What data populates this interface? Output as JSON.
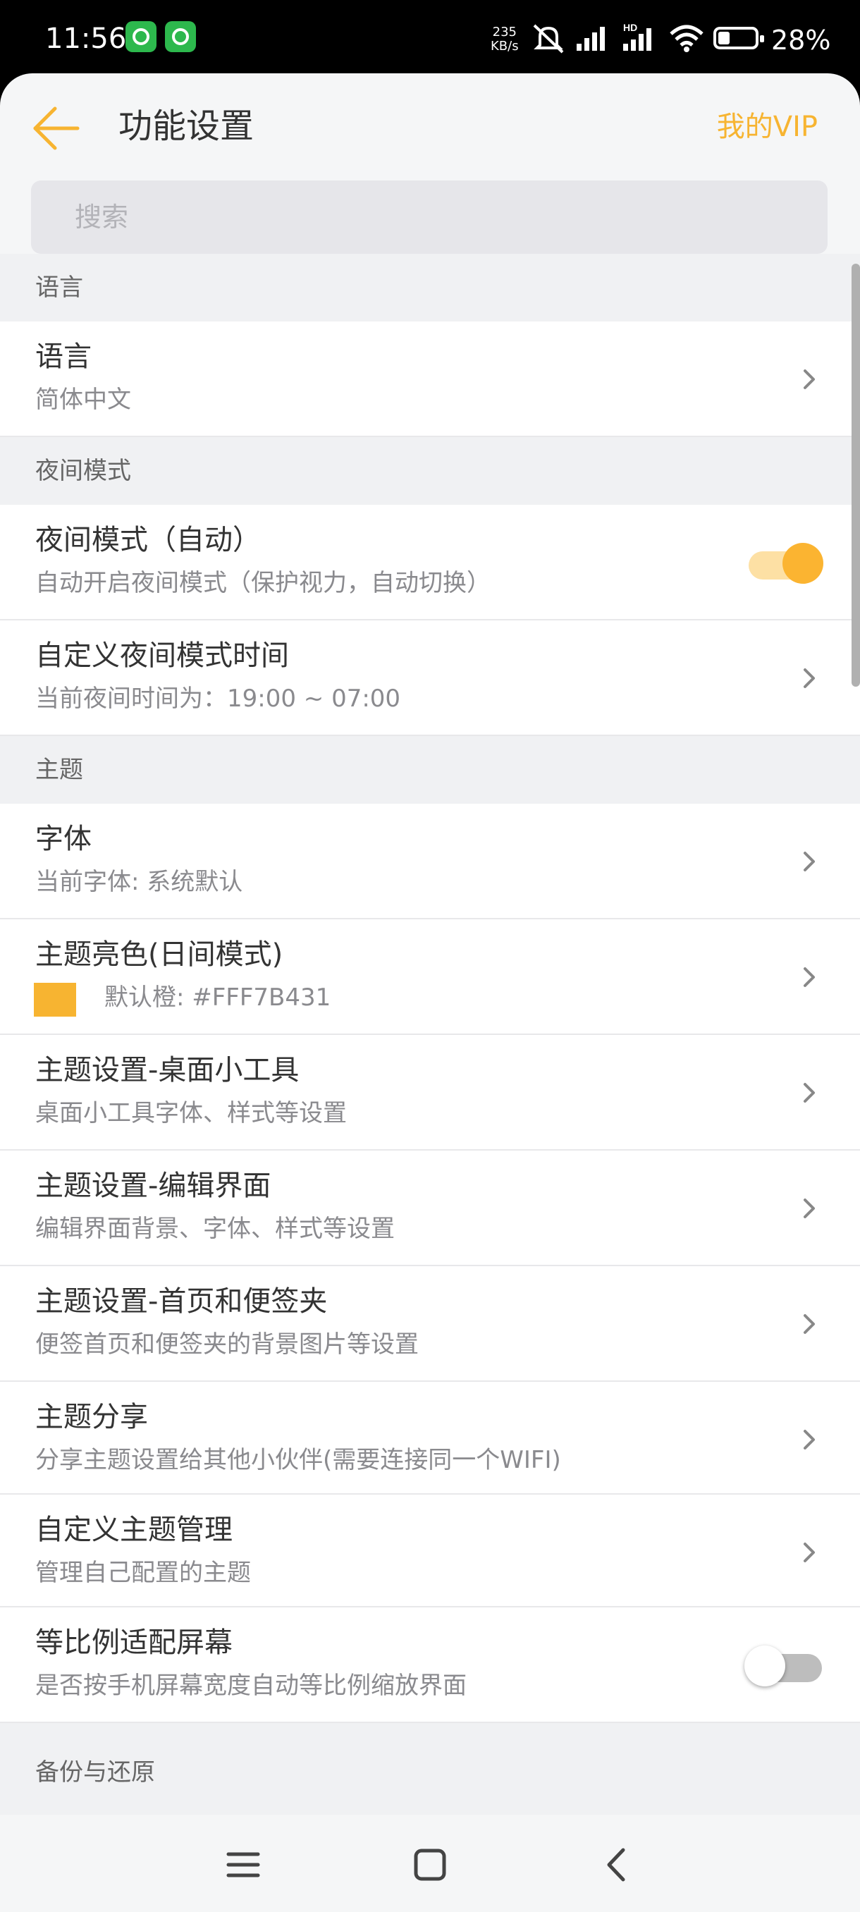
{
  "status_bar": {
    "time": "11:56",
    "net_speed_value": "235",
    "net_speed_unit": "KB/s",
    "battery": "28%",
    "icons": [
      "app-icon",
      "wechat-icon",
      "mute-icon",
      "signal-icon",
      "signal-hd-icon",
      "wifi-icon",
      "battery-icon"
    ]
  },
  "header": {
    "title": "功能设置",
    "vip_label": "我的VIP"
  },
  "search": {
    "placeholder": "搜索"
  },
  "sections": {
    "language": "语言",
    "night": "夜间模式",
    "theme": "主题",
    "backup": "备份与还原"
  },
  "items": {
    "language": {
      "title": "语言",
      "subtitle": "简体中文"
    },
    "night_auto": {
      "title": "夜间模式（自动）",
      "subtitle": "自动开启夜间模式（保护视力，自动切换）",
      "enabled": true
    },
    "night_time": {
      "title": "自定义夜间模式时间",
      "subtitle": "当前夜间时间为：19:00  ~  07:00"
    },
    "font": {
      "title": "字体",
      "subtitle": "当前字体: 系统默认"
    },
    "theme_color": {
      "title": "主题亮色(日间模式)",
      "subtitle": "默认橙: #FFF7B431",
      "swatch_color": "#F7B431"
    },
    "theme_widget": {
      "title": "主题设置-桌面小工具",
      "subtitle": "桌面小工具字体、样式等设置"
    },
    "theme_editor": {
      "title": "主题设置-编辑界面",
      "subtitle": "编辑界面背景、字体、样式等设置"
    },
    "theme_home": {
      "title": "主题设置-首页和便签夹",
      "subtitle": "便签首页和便签夹的背景图片等设置"
    },
    "theme_share": {
      "title": "主题分享",
      "subtitle": "分享主题设置给其他小伙伴(需要连接同一个WIFI)"
    },
    "theme_custom": {
      "title": "自定义主题管理",
      "subtitle": "管理自己配置的主题"
    },
    "scale_fit": {
      "title": "等比例适配屏幕",
      "subtitle": "是否按手机屏幕宽度自动等比例缩放界面",
      "enabled": false
    }
  },
  "colors": {
    "accent": "#F7B431",
    "background": "#F5F6F7",
    "section_bg": "#F0F1F3",
    "text_primary": "#333333",
    "text_secondary": "#8A8A8E"
  },
  "nav": {
    "icons": [
      "menu-icon",
      "home-square-icon",
      "back-chevron-icon"
    ]
  }
}
